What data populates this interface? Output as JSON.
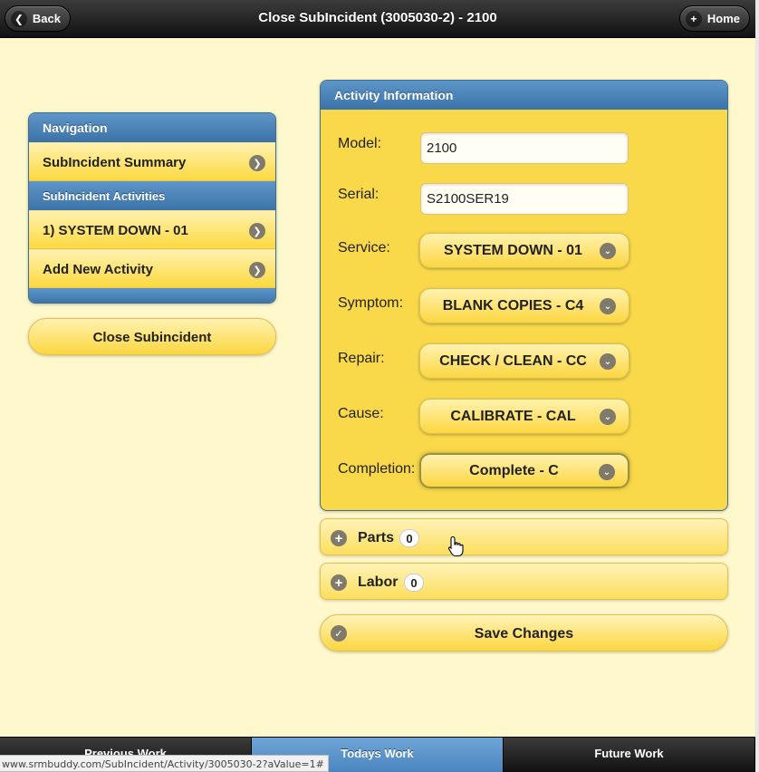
{
  "header": {
    "title": "Close SubIncident (3005030-2) - 2100",
    "back_label": "Back",
    "home_label": "Home"
  },
  "navigation": {
    "title": "Navigation",
    "summary_label": "SubIncident Summary",
    "activities_title": "SubIncident Activities",
    "items": [
      "1) SYSTEM DOWN - 01",
      "Add New Activity"
    ]
  },
  "close_button_label": "Close Subincident",
  "activity": {
    "title": "Activity Information",
    "model_label": "Model:",
    "model_value": "2100",
    "serial_label": "Serial:",
    "serial_value": "S2100SER19",
    "service_label": "Service:",
    "service_value": "SYSTEM DOWN - 01",
    "symptom_label": "Symptom:",
    "symptom_value": "BLANK COPIES - C4",
    "repair_label": "Repair:",
    "repair_value": "CHECK / CLEAN - CC",
    "cause_label": "Cause:",
    "cause_value": "CALIBRATE - CAL",
    "completion_label": "Completion:",
    "completion_value": "Complete - C"
  },
  "parts": {
    "label": "Parts",
    "count": "0"
  },
  "labor": {
    "label": "Labor",
    "count": "0"
  },
  "save_label": "Save Changes",
  "footer": {
    "tabs": [
      "Previous Work",
      "Todays Work",
      "Future Work"
    ],
    "active_tab": "Todays Work"
  },
  "status_url": "www.srmbuddy.com/SubIncident/Activity/3005030-2?aValue=1#",
  "colors": {
    "accent_blue": "#4a85bf",
    "panel_yellow": "#f9d94a",
    "page_background": "#fff8cc"
  },
  "icons": {
    "back": "arrow-left-icon",
    "home": "plus-icon",
    "list_item": "chevron-right-icon",
    "select": "chevron-down-icon",
    "collapsible": "plus-icon",
    "save": "check-icon"
  }
}
